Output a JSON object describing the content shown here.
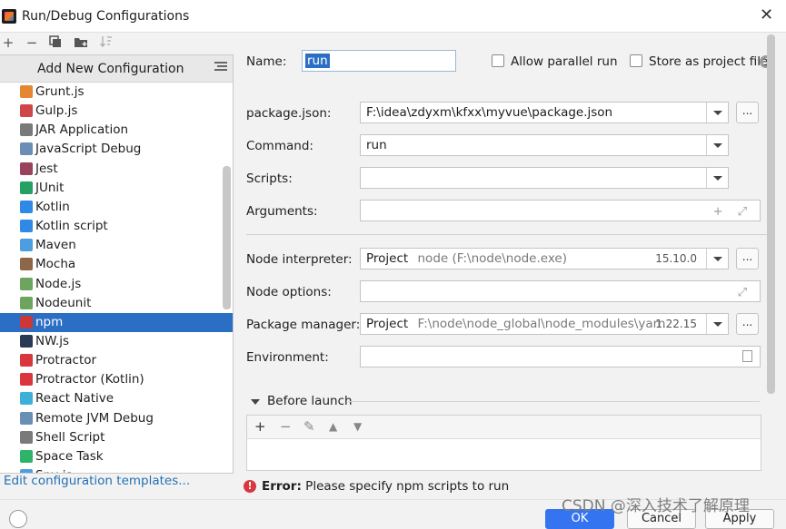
{
  "window": {
    "title": "Run/Debug Configurations"
  },
  "sidebar": {
    "add_new_label": "Add New Configuration",
    "items": [
      {
        "label": "Grunt.js",
        "icon": "grunt-icon",
        "color": "#e48632"
      },
      {
        "label": "Gulp.js",
        "icon": "gulp-icon",
        "color": "#cf4647"
      },
      {
        "label": "JAR Application",
        "icon": "jar-icon",
        "color": "#7a7a7a"
      },
      {
        "label": "JavaScript Debug",
        "icon": "js-debug-icon",
        "color": "#6b8eb5"
      },
      {
        "label": "Jest",
        "icon": "jest-icon",
        "color": "#99425b"
      },
      {
        "label": "JUnit",
        "icon": "junit-icon",
        "color": "#25a162"
      },
      {
        "label": "Kotlin",
        "icon": "kotlin-icon",
        "color": "#2e8ae6"
      },
      {
        "label": "Kotlin script",
        "icon": "kotlin-script-icon",
        "color": "#2e8ae6"
      },
      {
        "label": "Maven",
        "icon": "maven-icon",
        "color": "#4d9ee0"
      },
      {
        "label": "Mocha",
        "icon": "mocha-icon",
        "color": "#8d6748"
      },
      {
        "label": "Node.js",
        "icon": "nodejs-icon",
        "color": "#6da55f"
      },
      {
        "label": "Nodeunit",
        "icon": "nodeunit-icon",
        "color": "#6da55f"
      },
      {
        "label": "npm",
        "icon": "npm-icon",
        "color": "#cb3837",
        "selected": true
      },
      {
        "label": "NW.js",
        "icon": "nwjs-icon",
        "color": "#2a3a56"
      },
      {
        "label": "Protractor",
        "icon": "protractor-icon",
        "color": "#d9363e"
      },
      {
        "label": "Protractor (Kotlin)",
        "icon": "protractor-kotlin-icon",
        "color": "#d9363e"
      },
      {
        "label": "React Native",
        "icon": "react-icon",
        "color": "#3db0d9"
      },
      {
        "label": "Remote JVM Debug",
        "icon": "remote-debug-icon",
        "color": "#6b8eb5"
      },
      {
        "label": "Shell Script",
        "icon": "shell-icon",
        "color": "#7a7a7a"
      },
      {
        "label": "Space Task",
        "icon": "space-icon",
        "color": "#2fb36b"
      },
      {
        "label": "Spy-js",
        "icon": "spyjs-icon",
        "color": "#4d9ee0"
      }
    ],
    "edit_templates": "Edit configuration templates..."
  },
  "form": {
    "name_label": "Name:",
    "name_value": "run",
    "allow_parallel": "Allow parallel run",
    "store_as_project": "Store as project file",
    "package_json_label": "package.json:",
    "package_json_value": "F:\\idea\\zdyxm\\kfxx\\myvue\\package.json",
    "command_label": "Command:",
    "command_value": "run",
    "scripts_label": "Scripts:",
    "scripts_value": "",
    "arguments_label": "Arguments:",
    "node_interpreter_label": "Node interpreter:",
    "node_interpreter_main": "Project",
    "node_interpreter_path": "node (F:\\node\\node.exe)",
    "node_interpreter_version": "15.10.0",
    "node_options_label": "Node options:",
    "package_manager_label": "Package manager:",
    "package_manager_main": "Project",
    "package_manager_path": "F:\\node\\node_global\\node_modules\\yarn",
    "package_manager_version": "1.22.15",
    "environment_label": "Environment:",
    "before_launch": "Before launch",
    "dots": "..."
  },
  "error": {
    "prefix": "Error:",
    "message": "Please specify npm scripts to run"
  },
  "watermark": "CSDN @深入技术了解原理",
  "buttons": {
    "ok": "OK",
    "cancel": "Cancel",
    "apply": "Apply"
  },
  "colors": {
    "selection": "#2b6fc4",
    "link": "#2470b3",
    "error": "#d9363e",
    "primary": "#3574f0"
  }
}
